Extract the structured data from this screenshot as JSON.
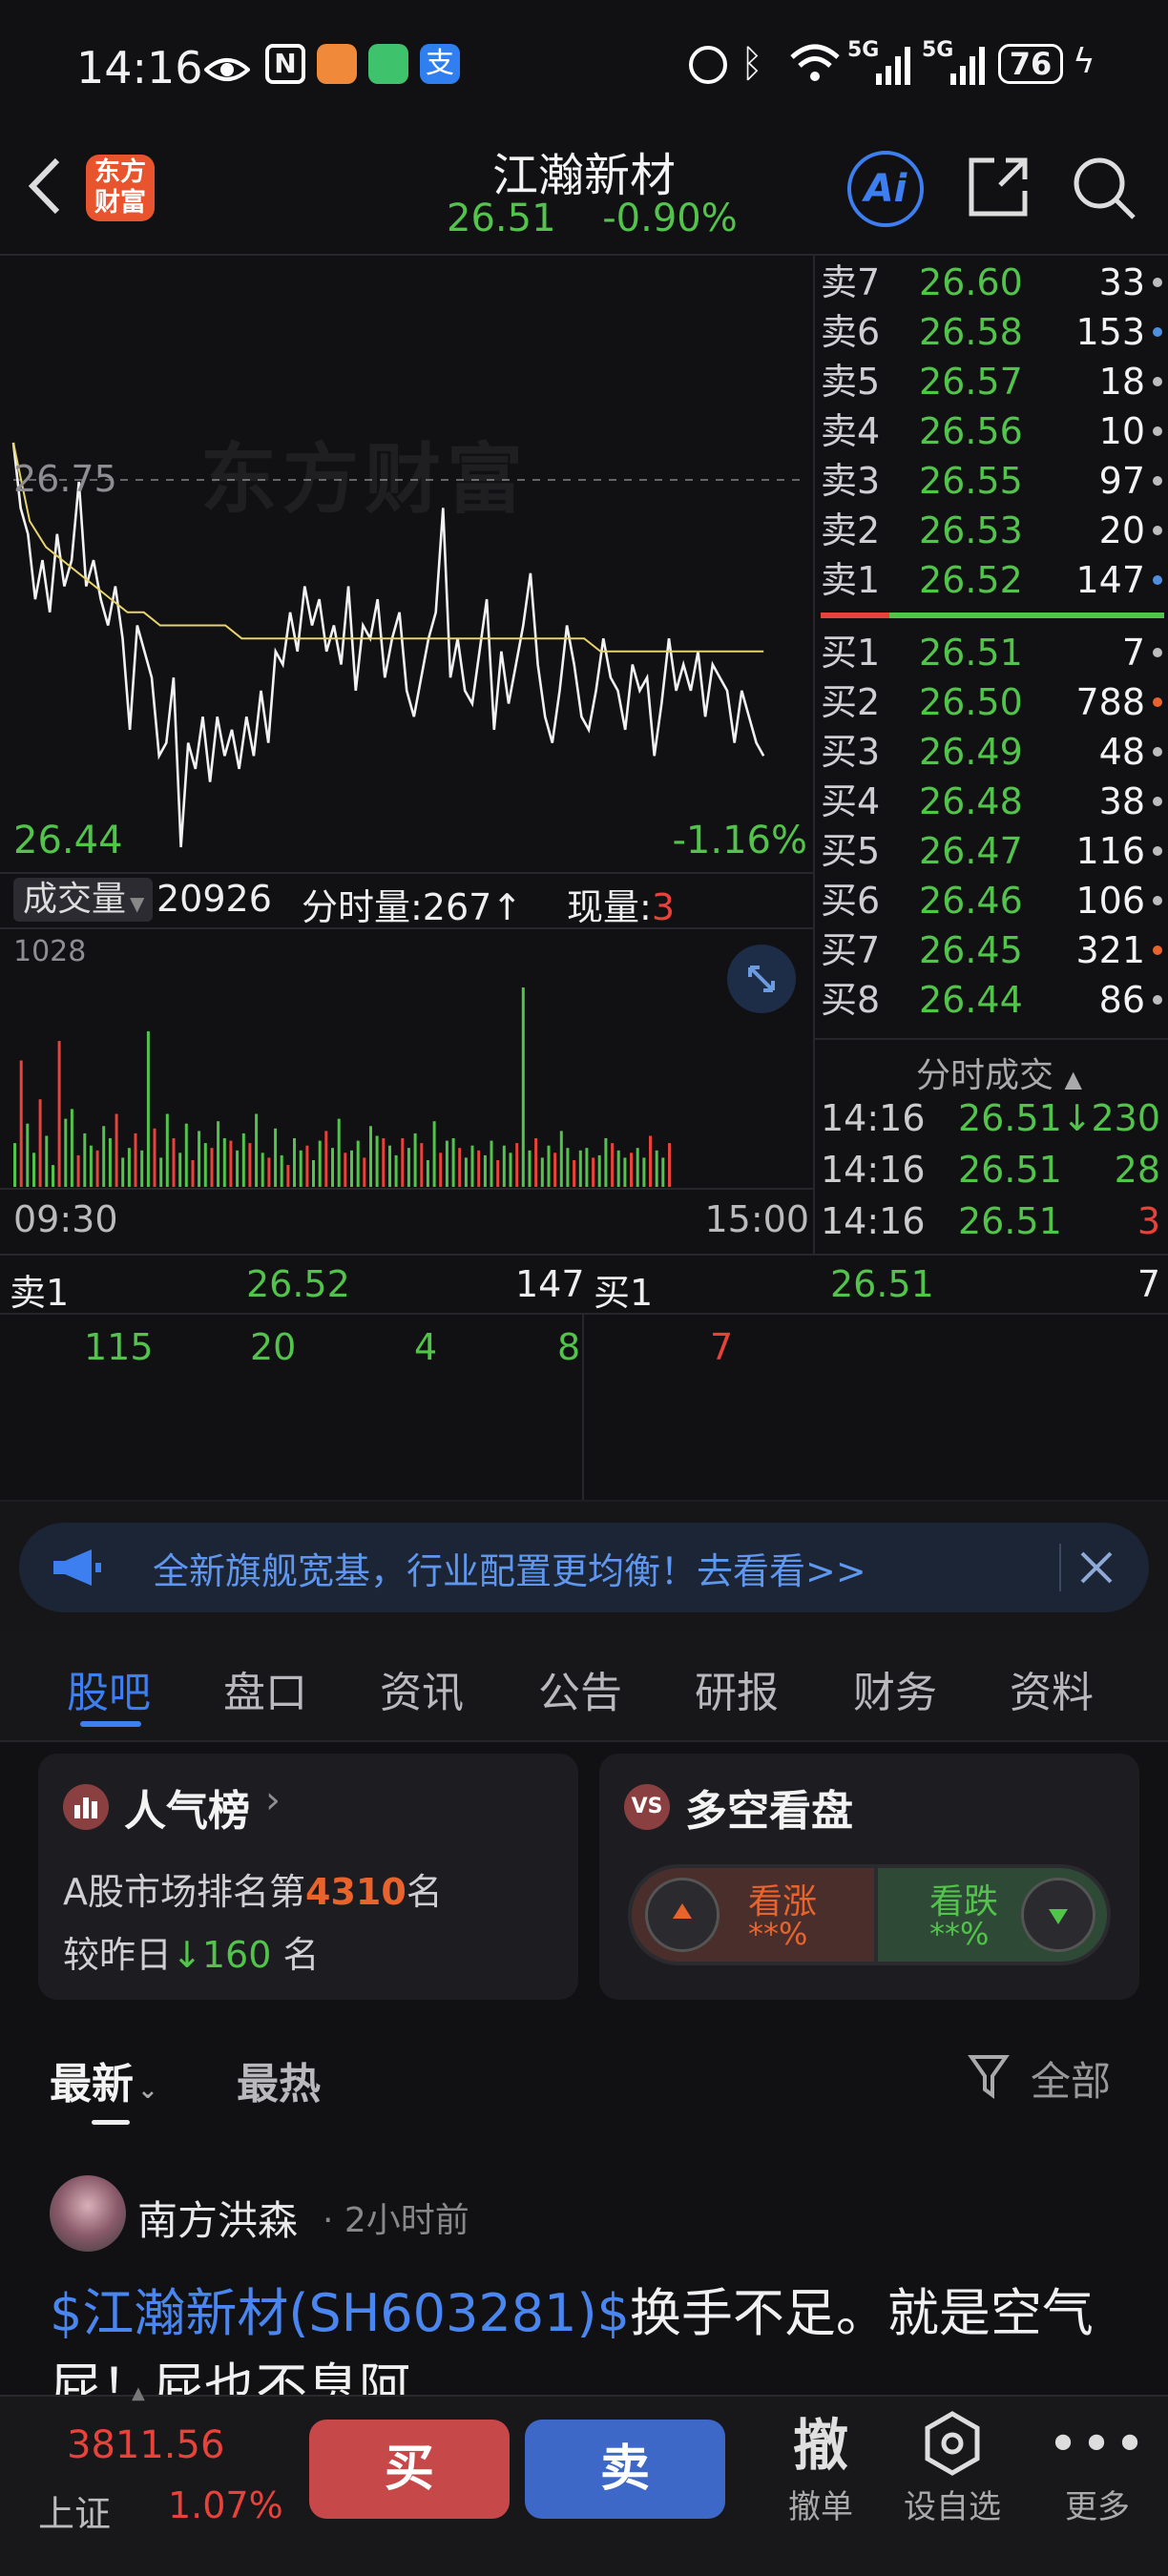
{
  "status_bar": {
    "time": "14:16",
    "network": "5G",
    "network2": "5G",
    "battery": "76"
  },
  "header": {
    "logo_text": "东方\n财富",
    "stock_name": "江瀚新材",
    "price": "26.51",
    "change_pct": "-0.90%",
    "ai_label": "Ai"
  },
  "chart": {
    "watermark": "东方财富",
    "price_high_label": "26.75",
    "price_low_label": "26.44",
    "change_low_label": "-1.16%",
    "volume_selector": "成交量",
    "total_volume": "20926",
    "tick_volume_label": "分时量:267↑",
    "current_volume_label": "现量:",
    "current_volume_value": "3",
    "volume_max_label": "1028",
    "time_start": "09:30",
    "time_end": "15:00"
  },
  "chart_data": {
    "type": "line",
    "title": "",
    "ylim": [
      26.44,
      26.75
    ],
    "x_range": [
      "09:30",
      "15:00"
    ],
    "series": [
      {
        "values": [
          26.75,
          26.7,
          26.68,
          26.63,
          26.66,
          26.62,
          26.68,
          26.64,
          26.66,
          26.72,
          26.64,
          26.66,
          26.63,
          26.61,
          26.64,
          26.6,
          26.53,
          26.61,
          26.59,
          26.57,
          26.51,
          26.52,
          26.57,
          26.44,
          26.52,
          26.5,
          26.54,
          26.49,
          26.54,
          26.51,
          26.53,
          26.5,
          26.54,
          26.51,
          26.56,
          26.52,
          26.59,
          26.58,
          26.62,
          26.59,
          26.64,
          26.61,
          26.63,
          26.59,
          26.61,
          26.58,
          26.64,
          26.56,
          26.61,
          26.6,
          26.63,
          26.57,
          26.6,
          26.62,
          26.56,
          26.54,
          26.57,
          26.6,
          26.62,
          26.7,
          26.57,
          26.6,
          26.56,
          26.55,
          26.59,
          26.63,
          26.53,
          26.59,
          26.55,
          26.58,
          26.61,
          26.65,
          26.58,
          26.54,
          26.52,
          26.56,
          26.61,
          26.58,
          26.54,
          26.53,
          26.56,
          26.6,
          26.57,
          26.56,
          26.53,
          26.58,
          26.56,
          26.57,
          26.51,
          26.55,
          26.6,
          26.56,
          26.58,
          26.56,
          26.59,
          26.54,
          26.58,
          26.57,
          26.56,
          26.52,
          26.56,
          26.54,
          26.52,
          26.51
        ]
      },
      {
        "values": [
          26.75,
          26.69,
          26.67,
          26.66,
          26.65,
          26.64,
          26.63,
          26.62,
          26.62,
          26.61,
          26.61,
          26.61,
          26.61,
          26.61,
          26.6,
          26.6,
          26.6,
          26.6,
          26.6,
          26.6,
          26.6,
          26.6,
          26.6,
          26.6,
          26.6,
          26.6,
          26.6,
          26.6,
          26.6,
          26.6,
          26.6,
          26.6,
          26.6,
          26.6,
          26.6,
          26.6,
          26.59,
          26.59,
          26.59,
          26.59,
          26.59,
          26.59,
          26.59,
          26.59,
          26.59,
          26.59,
          26.59
        ]
      }
    ],
    "volumes": [
      180,
      520,
      260,
      140,
      360,
      210,
      90,
      600,
      280,
      320,
      130,
      220,
      170,
      150,
      250,
      200,
      300,
      120,
      160,
      220,
      150,
      640,
      240,
      120,
      300,
      200,
      140,
      260,
      110,
      230,
      180,
      160,
      270,
      200,
      190,
      150,
      220,
      180,
      300,
      140,
      120,
      240,
      130,
      90,
      200,
      150,
      170,
      110,
      190,
      230,
      160,
      280,
      140,
      150,
      190,
      120,
      250,
      210,
      200,
      170,
      130,
      200,
      160,
      220,
      180,
      110,
      270,
      140,
      190,
      200,
      160,
      120,
      170,
      150,
      130,
      190,
      110,
      170,
      140,
      180,
      820,
      150,
      200,
      120,
      170,
      140,
      230,
      160,
      110,
      150,
      160,
      120,
      130,
      200,
      180,
      150,
      120,
      140,
      160,
      120,
      210,
      150,
      120,
      180
    ],
    "volume_ylim": [
      0,
      1028
    ]
  },
  "order_book": {
    "sells": [
      {
        "label": "卖7",
        "price": "26.60",
        "volume": "33",
        "dot": "#bdbdbd"
      },
      {
        "label": "卖6",
        "price": "26.58",
        "volume": "153",
        "dot": "#4f8fe0"
      },
      {
        "label": "卖5",
        "price": "26.57",
        "volume": "18",
        "dot": "#bdbdbd"
      },
      {
        "label": "卖4",
        "price": "26.56",
        "volume": "10",
        "dot": "#bdbdbd"
      },
      {
        "label": "卖3",
        "price": "26.55",
        "volume": "97",
        "dot": "#bdbdbd"
      },
      {
        "label": "卖2",
        "price": "26.53",
        "volume": "20",
        "dot": "#bdbdbd"
      },
      {
        "label": "卖1",
        "price": "26.52",
        "volume": "147",
        "dot": "#4f8fe0"
      }
    ],
    "buys": [
      {
        "label": "买1",
        "price": "26.51",
        "volume": "7",
        "dot": "#bdbdbd"
      },
      {
        "label": "买2",
        "price": "26.50",
        "volume": "788",
        "dot": "#e8642c"
      },
      {
        "label": "买3",
        "price": "26.49",
        "volume": "48",
        "dot": "#bdbdbd"
      },
      {
        "label": "买4",
        "price": "26.48",
        "volume": "38",
        "dot": "#bdbdbd"
      },
      {
        "label": "买5",
        "price": "26.47",
        "volume": "116",
        "dot": "#bdbdbd"
      },
      {
        "label": "买6",
        "price": "26.46",
        "volume": "106",
        "dot": "#bdbdbd"
      },
      {
        "label": "买7",
        "price": "26.45",
        "volume": "321",
        "dot": "#e8642c"
      },
      {
        "label": "买8",
        "price": "26.44",
        "volume": "86",
        "dot": "#bdbdbd"
      }
    ]
  },
  "trades": {
    "title": "分时成交",
    "rows": [
      {
        "time": "14:16",
        "price": "26.51↓",
        "volume": "230"
      },
      {
        "time": "14:16",
        "price": "26.51",
        "volume": "28"
      },
      {
        "time": "14:16",
        "price": "26.51",
        "volume": "3"
      }
    ]
  },
  "queue": {
    "sell_label": "卖1",
    "sell_price": "26.52",
    "sell_volume": "147",
    "buy_label": "买1",
    "buy_price": "26.51",
    "buy_volume": "7",
    "sell_orders": [
      "115",
      "20",
      "4",
      "8"
    ],
    "buy_orders": [
      "7"
    ]
  },
  "banner": {
    "text": "全新旗舰宽基，行业配置更均衡！去看看>>"
  },
  "tabs": [
    "股吧",
    "盘口",
    "资讯",
    "公告",
    "研报",
    "财务",
    "资料"
  ],
  "popularity": {
    "title": "人气榜",
    "rank_prefix": "A股市场排名第",
    "rank": "4310",
    "rank_suffix": "名",
    "change_prefix": "较昨日",
    "change": "160",
    "change_suffix": "名"
  },
  "sentiment": {
    "title": "多空看盘",
    "bull_label": "看涨",
    "bull_pct": "**%",
    "bear_label": "看跌",
    "bear_pct": "**%"
  },
  "feed": {
    "sort_latest": "最新",
    "sort_hot": "最热",
    "filter_label": "全部",
    "post": {
      "author": "南方洪森",
      "time": "· 2小时前",
      "stock_tag": "$江瀚新材(SH603281)$",
      "text": "换手不足。就是空气",
      "text_line2": "屁！屁也不臭阿"
    }
  },
  "bottom_bar": {
    "index_value": "3811.56",
    "index_name": "上证",
    "index_change": "1.07%",
    "buy": "买",
    "sell": "卖",
    "cancel_glyph": "撤",
    "cancel": "撤单",
    "watchlist": "设自选",
    "more": "更多"
  },
  "colors": {
    "up": "#e8423a",
    "down": "#52c34b",
    "accent": "#3d7ff0",
    "background": "#111114"
  }
}
